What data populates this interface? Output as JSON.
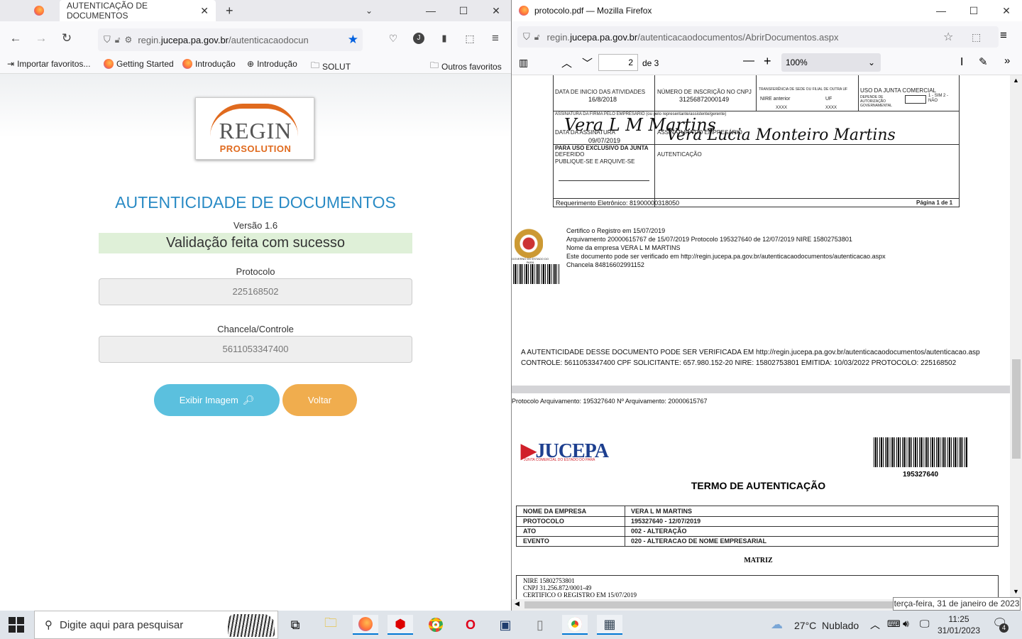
{
  "left_browser": {
    "tab_title": "AUTENTICAÇÃO DE DOCUMENTOS",
    "url_prefix": "regin.",
    "url_domain": "jucepa.pa.gov.br",
    "url_path": "/autenticacaodocun",
    "bookmarks": [
      "Importar favoritos...",
      "Getting Started",
      "Introdução",
      "Introdução",
      "SOLUT"
    ],
    "other_bookmarks": "Outros favoritos"
  },
  "page": {
    "logo_text": "REGIN",
    "logo_sub": "PROSOLUTION",
    "title": "AUTENTICIDADE DE DOCUMENTOS",
    "version": "Versão 1.6",
    "success": "Validação feita com sucesso",
    "protocolo_label": "Protocolo",
    "protocolo_value": "225168502",
    "chancela_label": "Chancela/Controle",
    "chancela_value": "5611053347400",
    "btn_image": "Exibir Imagem",
    "btn_back": "Voltar"
  },
  "right_window": {
    "title": "protocolo.pdf — Mozilla Firefox",
    "url_prefix": "regin.",
    "url_domain": "jucepa.pa.gov.br",
    "url_path": "/autenticacaodocumentos/AbrirDocumentos.aspx",
    "page_number": "2",
    "page_total": "de 3",
    "zoom": "100%"
  },
  "pdf_page2": {
    "f1_label": "DATA DE INICIO DAS ATIVIDADES",
    "f1_value": "16/8/2018",
    "f2_label": "NÚMERO DE INSCRIÇÃO NO CNPJ",
    "f2_value": "31256872000149",
    "f3_label": "TRANSFERÊNCIA DE SEDE OU FILIAL DE OUTRA UF",
    "f3_nire": "NIRE anterior",
    "f3_uf": "UF",
    "f3_x1": "XXXX",
    "f3_x2": "XXXX",
    "f4_label": "USO DA JUNTA COMERCIAL",
    "f4_sub": "DEPENDE DE AUTORIZAÇÃO GOVERNAMENTAL",
    "f4_opts": "1 - SIM 2 - NÃO",
    "sig_label": "ASSINATURA DA FIRMA PELO EMPRESÁRIO (ou pelo representante/assistente/gerente)",
    "sig1": "Vera L M Martins",
    "date_label": "DATA DA ASSINATURA",
    "date_value": "09/07/2019",
    "emp_sig_label": "ASSINATURA DO EMPRESÁRIO",
    "sig2": "Vera Lucia Monteiro Martins",
    "uso_label": "PARA USO EXCLUSIVO DA JUNTA",
    "deferido": "DEFERIDO",
    "publique": "PUBLIQUE-SE E ARQUIVE-SE",
    "autenticacao": "AUTENTICAÇÃO",
    "req": "Requerimento Eletrônico: 81900000318050",
    "pagina": "Página 1 de 1",
    "cert": [
      "Certifico o Registro em 15/07/2019",
      "Arquivamento 20000615767 de 15/07/2019 Protocolo 195327640 de 12/07/2019 NIRE 15802753801",
      "Nome da empresa VERA L M MARTINS",
      "Este documento pode ser verificado em http://regin.jucepa.pa.gov.br/autenticacaodocumentos/autenticacao.aspx",
      "Chancela 84816602991152"
    ],
    "seal_caption": "GOVERNO DO ESTADO DO PARÁ",
    "auth_line1": "A AUTENTICIDADE DESSE DOCUMENTO PODE SER VERIFICADA EM http://regin.jucepa.pa.gov.br/autenticacaodocumentos/autenticacao.asp",
    "auth_line2": "CONTROLE: 5611053347400 CPF SOLICITANTE: 657.980.152-20 NIRE: 15802753801 EMITIDA: 10/03/2022 PROTOCOLO: 225168502"
  },
  "pdf_page3": {
    "header": "Protocolo Arquivamento: 195327640 Nº Arquivamento: 20000615767",
    "logo": "JUCEPA",
    "logo_sub": "JUNTA COMERCIAL DO ESTADO DO PARÁ",
    "barcode_number": "195327640",
    "heading": "TERMO DE AUTENTICAÇÃO",
    "rows": [
      {
        "k": "NOME DA EMPRESA",
        "v": "VERA L M MARTINS"
      },
      {
        "k": "PROTOCOLO",
        "v": "195327640 - 12/07/2019"
      },
      {
        "k": "ATO",
        "v": "002 - ALTERAÇÃO"
      },
      {
        "k": "EVENTO",
        "v": "020 - ALTERACAO DE NOME EMPRESARIAL"
      }
    ],
    "matriz": "MATRIZ",
    "m1": "NIRE 15802753801",
    "m2": "CNPJ 31.256.872/0001-49",
    "m3": "CERTIFICO O REGISTRO EM 15/07/2019"
  },
  "taskbar": {
    "search_placeholder": "Digite aqui para pesquisar",
    "weather": "27°C  Nublado",
    "time": "11:25",
    "date": "31/01/2023",
    "tooltip": "terça-feira, 31 de janeiro de 2023",
    "notif_count": "4"
  }
}
